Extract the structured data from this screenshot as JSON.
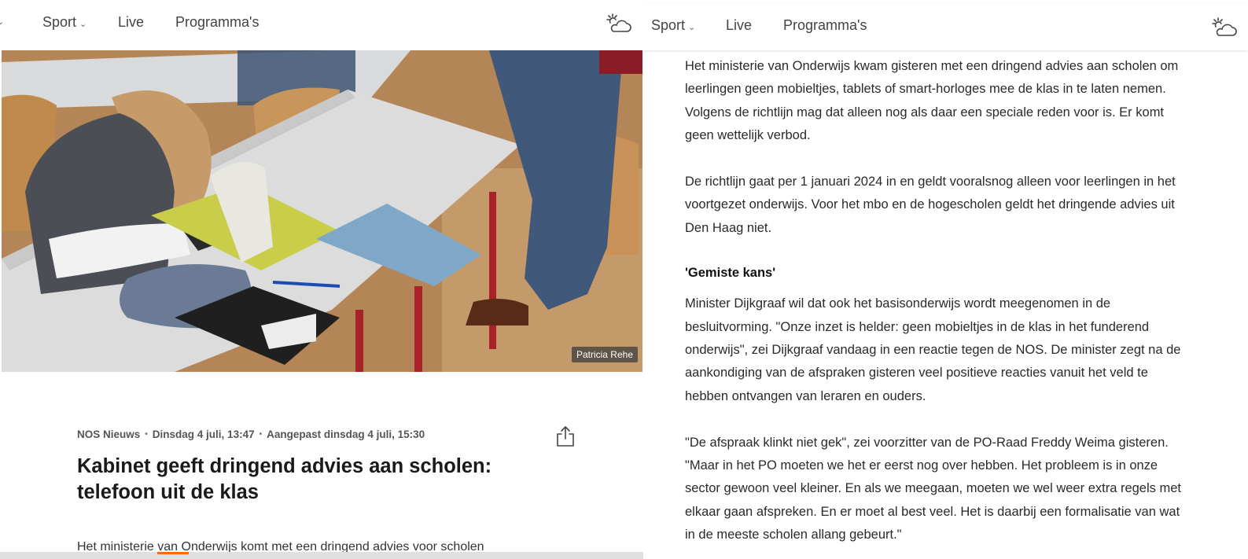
{
  "left": {
    "nav": {
      "cut_chevron": "⌄",
      "sport": "Sport",
      "live": "Live",
      "programmas": "Programma's",
      "weather_icon": "weather-sun-cloud-icon"
    },
    "photo": {
      "credit": "Patricia Rehe"
    },
    "article": {
      "source": "NOS Nieuws",
      "date": "Dinsdag 4 juli, 13:47",
      "updated": "Aangepast dinsdag 4 juli, 15:30",
      "headline": "Kabinet geeft dringend advies aan scholen: telefoon uit de klas",
      "lead": "Het ministerie van Onderwijs komt met een dringend advies voor scholen"
    }
  },
  "right": {
    "nav": {
      "sport": "Sport",
      "live": "Live",
      "programmas": "Programma's"
    },
    "article": {
      "p1": "Het ministerie van Onderwijs kwam gisteren met een dringend advies aan scholen om leerlingen geen mobieltjes, tablets of smart-horloges mee de klas in te laten nemen. Volgens de richtlijn mag dat alleen nog als daar een speciale reden voor is. Er komt geen wettelijk verbod.",
      "p2": "De richtlijn gaat per 1 januari 2024 in en geldt vooralsnog alleen voor leerlingen in het voortgezet onderwijs. Voor het mbo en de hogescholen geldt het dringende advies uit Den Haag niet.",
      "subheading": "'Gemiste kans'",
      "p3": "Minister Dijkgraaf wil dat ook het basisonderwijs wordt meegenomen in de besluitvorming. \"Onze inzet is helder: geen mobieltjes in de klas in het funderend onderwijs\", zei Dijkgraaf vandaag in een reactie tegen de NOS. De minister zegt na de aankondiging van de afspraken gisteren veel positieve reacties vanuit het veld te hebben ontvangen van leraren en ouders.",
      "p4": "\"De afspraak klinkt niet gek\", zei voorzitter van de PO-Raad Freddy Weima gisteren. \"Maar in het PO moeten we het er eerst nog over hebben. Het probleem is in onze sector gewoon veel kleiner. En als we meegaan, moeten we wel weer extra regels met elkaar gaan afspreken. En er moet al best veel. Het is daarbij een formalisatie van wat in de meeste scholen allang gebeurt.\""
    }
  },
  "colors": {
    "accent": "#ff6d00",
    "text": "#2a2a2a"
  }
}
